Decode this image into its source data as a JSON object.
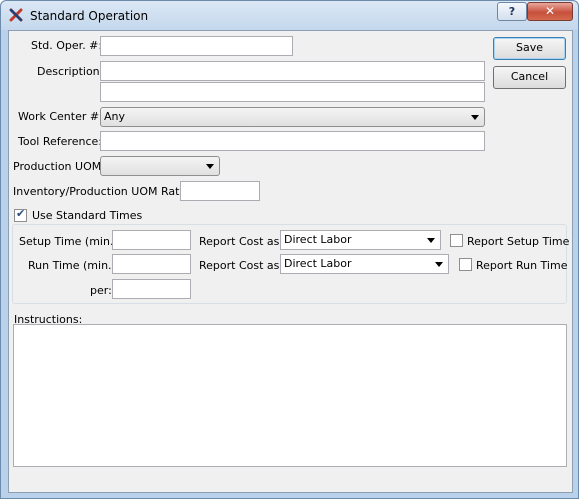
{
  "window": {
    "title": "Standard Operation",
    "help_label": "?",
    "close_label": "✕"
  },
  "form": {
    "std_oper_label": "Std. Oper. #:",
    "std_oper_value": "",
    "description_label": "Description:",
    "description1_value": "",
    "description2_value": "",
    "work_center_label": "Work Center #:",
    "work_center_value": "Any",
    "tool_reference_label": "Tool Reference:",
    "tool_reference_value": "",
    "production_uom_label": "Production UOM:",
    "production_uom_value": "",
    "inv_prod_ratio_label": "Inventory/Production UOM Ratio:",
    "inv_prod_ratio_value": "",
    "use_standard_times_label": "Use Standard Times",
    "use_standard_times_checked": true,
    "setup_time_label": "Setup Time (min.):",
    "setup_time_value": "",
    "report_cost_as_label_1": "Report Cost as:",
    "report_cost_as_value_1": "Direct Labor",
    "report_setup_time_label": "Report Setup Time",
    "run_time_label": "Run Time (min.):",
    "run_time_value": "",
    "report_cost_as_label_2": "Report Cost as:",
    "report_cost_as_value_2": "Direct Labor",
    "report_run_time_label": "Report Run Time",
    "per_label": "per:",
    "per_value": "",
    "instructions_label": "Instructions:",
    "instructions_value": ""
  },
  "buttons": {
    "save_label": "Save",
    "cancel_label": "Cancel"
  }
}
